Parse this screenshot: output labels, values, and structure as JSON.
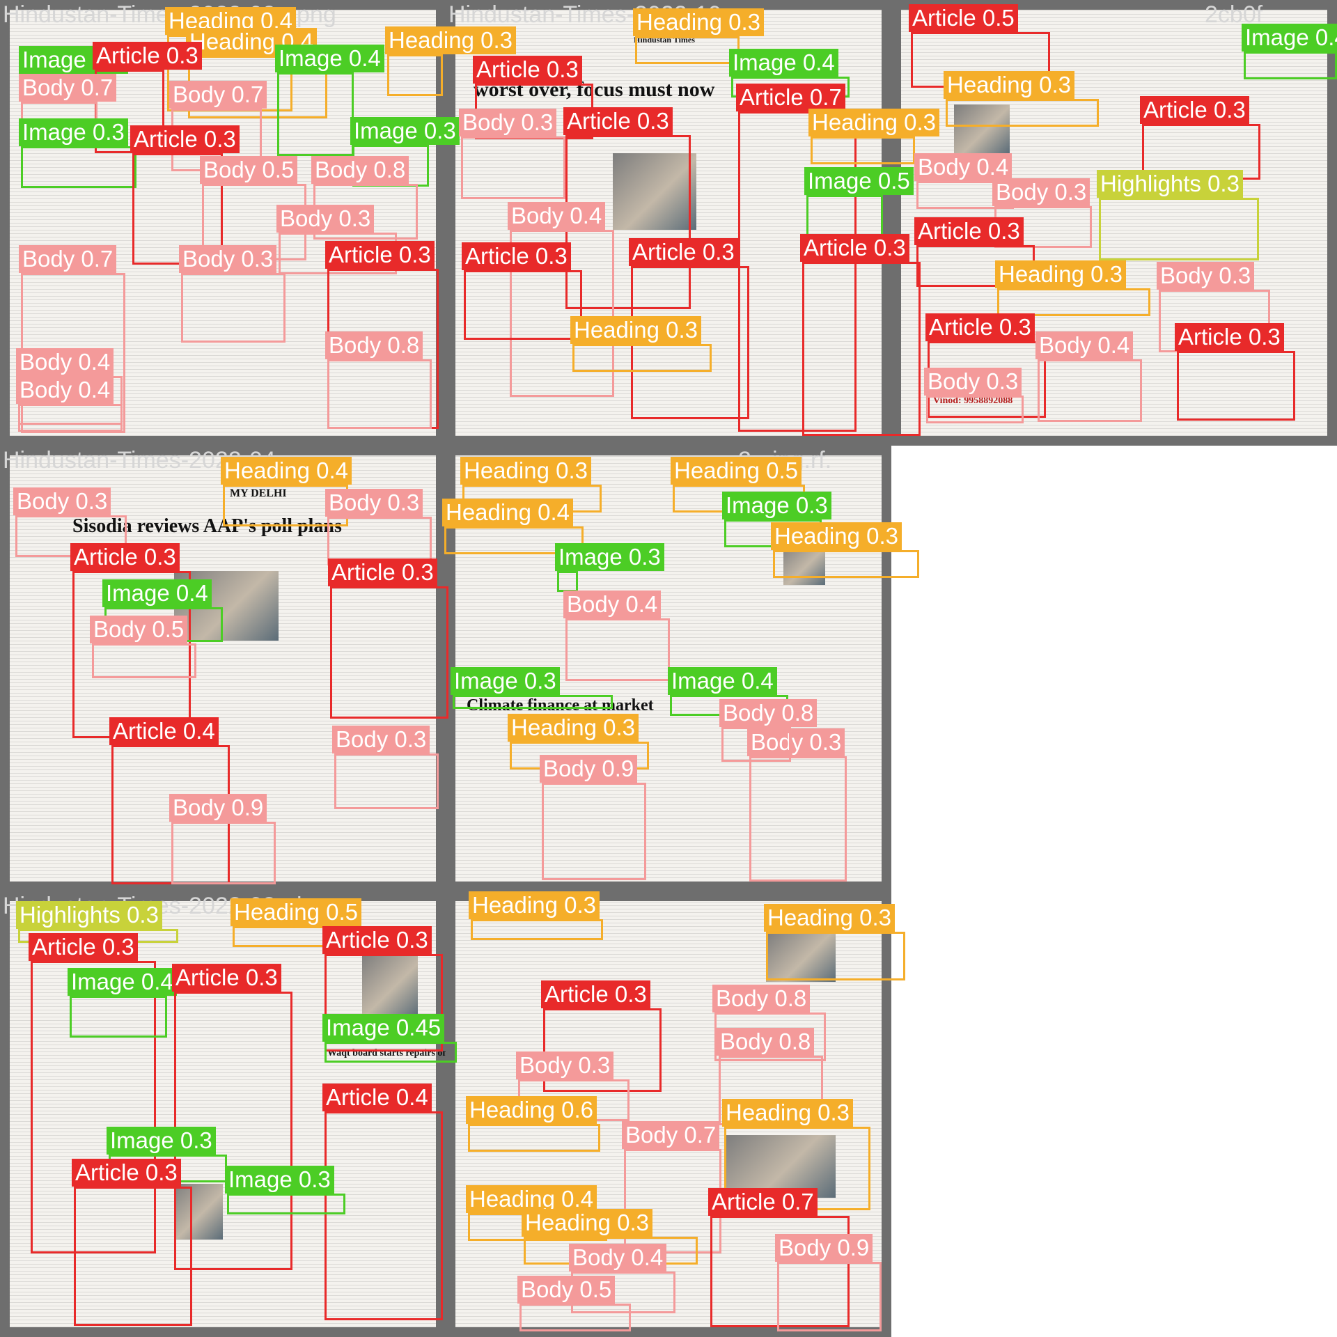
{
  "tiles": [
    {
      "filename": "Hindustan-Times-2022-02-_png"
    },
    {
      "filename": "Hindustan-Times-2022-10-"
    },
    {
      "filename": "2cb0f"
    },
    {
      "filename": "Hindustan-Times-2022-04-"
    },
    {
      "filename": "2-_jpg.rf."
    },
    {
      "filename": "Hindustan-Times-2022-02-_jpg"
    },
    {
      "filename": "bc577"
    }
  ],
  "newspaper_text": [
    {
      "text": "Sisodia reviews AAP's poll plans"
    },
    {
      "text": "Climate finance at market"
    },
    {
      "text": "Waqt board starts repairs on leaning"
    },
    {
      "text": "MY DELHI"
    },
    {
      "text": "Hindustan Times"
    },
    {
      "text": "Vinod: 9958892088"
    },
    {
      "text": "worst over, focus must now"
    }
  ],
  "class_colors": {
    "Article": "#e82a2a",
    "Body": "#f49a9a",
    "Heading": "#f5ae2a",
    "Image": "#4ccd25",
    "Highlights": "#c8d23a"
  },
  "detections": [
    {
      "label": "Heading 0.4"
    },
    {
      "label": "Heading 0.4"
    },
    {
      "label": "Heading 0.3"
    },
    {
      "label": "Image 0.3"
    },
    {
      "label": "Article 0.3"
    },
    {
      "label": "Image 0.4"
    },
    {
      "label": "Body 0.7"
    },
    {
      "label": "Body 0.7"
    },
    {
      "label": "Image 0.3"
    },
    {
      "label": "Article 0.3"
    },
    {
      "label": "Image 0.3"
    },
    {
      "label": "Body 0.5"
    },
    {
      "label": "Body 0.8"
    },
    {
      "label": "Body 0.3"
    },
    {
      "label": "Body 0.7"
    },
    {
      "label": "Body 0.3"
    },
    {
      "label": "Article 0.3"
    },
    {
      "label": "Body 0.4"
    },
    {
      "label": "Body 0.4"
    },
    {
      "label": "Body 0.8"
    },
    {
      "label": "Heading 0.3"
    },
    {
      "label": "Article 0.3"
    },
    {
      "label": "Body 0.3"
    },
    {
      "label": "Article 0.3"
    },
    {
      "label": "Image 0.4"
    },
    {
      "label": "Article 0.7"
    },
    {
      "label": "Heading 0.3"
    },
    {
      "label": "Image 0.5"
    },
    {
      "label": "Body 0.4"
    },
    {
      "label": "Article 0.3"
    },
    {
      "label": "Article 0.3"
    },
    {
      "label": "Article 0.3"
    },
    {
      "label": "Heading 0.3"
    },
    {
      "label": "Article 0.5"
    },
    {
      "label": "Heading 0.3"
    },
    {
      "label": "Image 0.4"
    },
    {
      "label": "Article 0.3"
    },
    {
      "label": "Body 0.4"
    },
    {
      "label": "Highlights 0.3"
    },
    {
      "label": "Body 0.3"
    },
    {
      "label": "Article 0.3"
    },
    {
      "label": "Heading 0.3"
    },
    {
      "label": "Body 0.3"
    },
    {
      "label": "Article 0.3"
    },
    {
      "label": "Body 0.4"
    },
    {
      "label": "Article 0.3"
    },
    {
      "label": "Body 0.3"
    },
    {
      "label": "Heading 0.4"
    },
    {
      "label": "Body 0.3"
    },
    {
      "label": "Body 0.3"
    },
    {
      "label": "Article 0.3"
    },
    {
      "label": "Image 0.4"
    },
    {
      "label": "Article 0.3"
    },
    {
      "label": "Body 0.5"
    },
    {
      "label": "Article 0.4"
    },
    {
      "label": "Body 0.3"
    },
    {
      "label": "Body 0.9"
    },
    {
      "label": "Heading 0.3"
    },
    {
      "label": "Heading 0.5"
    },
    {
      "label": "Heading 0.4"
    },
    {
      "label": "Image 0.3"
    },
    {
      "label": "Heading 0.3"
    },
    {
      "label": "Image 0.3"
    },
    {
      "label": "Body 0.4"
    },
    {
      "label": "Image 0.3"
    },
    {
      "label": "Image 0.4"
    },
    {
      "label": "Heading 0.3"
    },
    {
      "label": "Body 0.3"
    },
    {
      "label": "Body 0.9"
    },
    {
      "label": "Body 0.8"
    },
    {
      "label": "Highlights 0.3"
    },
    {
      "label": "Heading 0.5"
    },
    {
      "label": "Article 0.3"
    },
    {
      "label": "Article 0.3"
    },
    {
      "label": "Image 0.4"
    },
    {
      "label": "Article 0.3"
    },
    {
      "label": "Image 0.45"
    },
    {
      "label": "Article 0.4"
    },
    {
      "label": "Image 0.3"
    },
    {
      "label": "Article 0.3"
    },
    {
      "label": "Image 0.3"
    },
    {
      "label": "Heading 0.3"
    },
    {
      "label": "Heading 0.3"
    },
    {
      "label": "Article 0.3"
    },
    {
      "label": "Body 0.8"
    },
    {
      "label": "Body 0.8"
    },
    {
      "label": "Body 0.3"
    },
    {
      "label": "Heading 0.6"
    },
    {
      "label": "Heading 0.3"
    },
    {
      "label": "Body 0.7"
    },
    {
      "label": "Heading 0.4"
    },
    {
      "label": "Heading 0.3"
    },
    {
      "label": "Article 0.7"
    },
    {
      "label": "Body 0.4"
    },
    {
      "label": "Body 0.5"
    },
    {
      "label": "Body 0.9"
    }
  ]
}
